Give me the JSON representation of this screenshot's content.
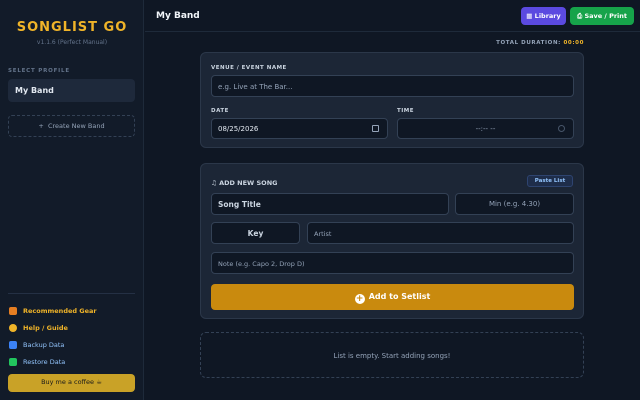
{
  "sidebar": {
    "brand": "SONGLIST GO",
    "version": "v1.1.6 (Perfect Manual)",
    "select_profile_label": "SELECT PROFILE",
    "profile": "My Band",
    "new_band": "Create New Band",
    "links": {
      "gear": "Recommended Gear",
      "guide": "Help / Guide",
      "backup": "Backup Data",
      "restore": "Restore Data"
    },
    "coffee": "Buy me a coffee ☕"
  },
  "header": {
    "title": "My Band",
    "library": "Library",
    "save": "Save / Print"
  },
  "duration": {
    "label": "TOTAL DURATION:",
    "value": "00:00"
  },
  "event": {
    "venue_label": "VENUE / EVENT NAME",
    "venue_placeholder": "e.g. Live at The Bar...",
    "date_label": "DATE",
    "date_value": "08/25/2026",
    "time_label": "TIME",
    "time_value": "--:-- --"
  },
  "song": {
    "title": "ADD NEW SONG",
    "paste": "Paste List",
    "title_placeholder": "Song Title",
    "min_placeholder": "Min (e.g. 4.30)",
    "key_placeholder": "Key",
    "artist_placeholder": "Artist",
    "note_placeholder": "Note (e.g. Capo 2, Drop D)",
    "add_button": "Add to Setlist"
  },
  "empty_message": "List is empty. Start adding songs!",
  "colors": {
    "accent": "#f0b429",
    "library": "#5b4ae0",
    "save": "#16a34a",
    "add": "#c98a0e"
  }
}
